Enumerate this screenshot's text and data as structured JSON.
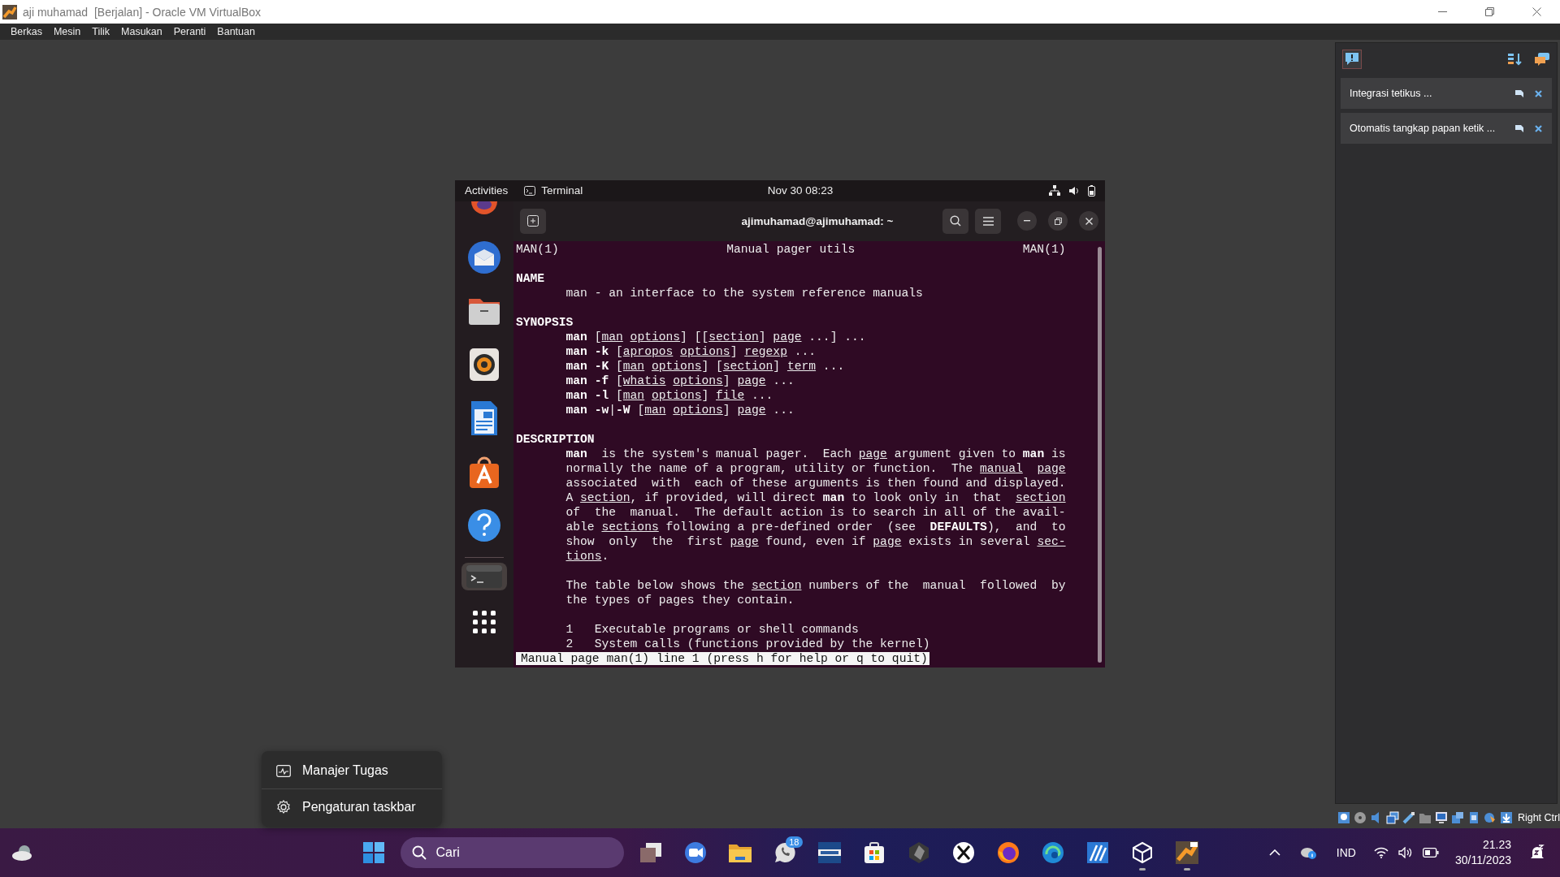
{
  "window": {
    "title": "aji muhamad  [Berjalan] - Oracle VM VirtualBox"
  },
  "menu": [
    "Berkas",
    "Mesin",
    "Tilik",
    "Masukan",
    "Peranti",
    "Bantuan"
  ],
  "notifications": [
    {
      "text": "Integrasi tetikus ..."
    },
    {
      "text": "Otomatis tangkap papan ketik ..."
    }
  ],
  "guest": {
    "top_bar": {
      "activities": "Activities",
      "app": "Terminal",
      "clock": "Nov 30  08:23"
    },
    "dock": [
      {
        "active": false
      },
      {
        "active": false
      },
      {
        "active": false
      },
      {
        "active": false
      },
      {
        "active": false
      },
      {
        "active": false
      },
      {
        "active": false
      },
      {
        "active": true
      },
      {
        "active": false
      }
    ],
    "terminal": {
      "title": "ajimuhamad@ajimuhamad: ~",
      "header": {
        "left": "MAN(1)",
        "center": "Manual pager utils",
        "right": "MAN(1)"
      },
      "lines": [
        {
          "kind": "blank"
        },
        {
          "kind": "heading",
          "segments": [
            {
              "text": "NAME",
              "kind": "bold"
            }
          ]
        },
        {
          "kind": "body",
          "segments": [
            {
              "text": "man - an interface to the system reference manuals",
              "kind": "plain"
            }
          ]
        },
        {
          "kind": "blank"
        },
        {
          "kind": "heading",
          "segments": [
            {
              "text": "SYNOPSIS",
              "kind": "bold"
            }
          ]
        },
        {
          "kind": "body",
          "segments": [
            {
              "text": "man",
              "kind": "bold"
            },
            {
              "text": " [",
              "kind": "plain"
            },
            {
              "text": "man options",
              "kind": "underline"
            },
            {
              "text": "] [[",
              "kind": "plain"
            },
            {
              "text": "section",
              "kind": "underline"
            },
            {
              "text": "] ",
              "kind": "plain"
            },
            {
              "text": "page",
              "kind": "underline"
            },
            {
              "text": " ...] ...",
              "kind": "plain"
            }
          ]
        },
        {
          "kind": "body",
          "segments": [
            {
              "text": "man -k",
              "kind": "bold"
            },
            {
              "text": " [",
              "kind": "plain"
            },
            {
              "text": "apropos options",
              "kind": "underline"
            },
            {
              "text": "] ",
              "kind": "plain"
            },
            {
              "text": "regexp",
              "kind": "underline"
            },
            {
              "text": " ...",
              "kind": "plain"
            }
          ]
        },
        {
          "kind": "body",
          "segments": [
            {
              "text": "man -K",
              "kind": "bold"
            },
            {
              "text": " [",
              "kind": "plain"
            },
            {
              "text": "man options",
              "kind": "underline"
            },
            {
              "text": "] [",
              "kind": "plain"
            },
            {
              "text": "section",
              "kind": "underline"
            },
            {
              "text": "] ",
              "kind": "plain"
            },
            {
              "text": "term",
              "kind": "underline"
            },
            {
              "text": " ...",
              "kind": "plain"
            }
          ]
        },
        {
          "kind": "body",
          "segments": [
            {
              "text": "man -f",
              "kind": "bold"
            },
            {
              "text": " [",
              "kind": "plain"
            },
            {
              "text": "whatis options",
              "kind": "underline"
            },
            {
              "text": "] ",
              "kind": "plain"
            },
            {
              "text": "page",
              "kind": "underline"
            },
            {
              "text": " ...",
              "kind": "plain"
            }
          ]
        },
        {
          "kind": "body",
          "segments": [
            {
              "text": "man -l",
              "kind": "bold"
            },
            {
              "text": " [",
              "kind": "plain"
            },
            {
              "text": "man options",
              "kind": "underline"
            },
            {
              "text": "] ",
              "kind": "plain"
            },
            {
              "text": "file",
              "kind": "underline"
            },
            {
              "text": " ...",
              "kind": "plain"
            }
          ]
        },
        {
          "kind": "body",
          "segments": [
            {
              "text": "man -w",
              "kind": "bold"
            },
            {
              "text": "|",
              "kind": "plain"
            },
            {
              "text": "-W",
              "kind": "bold"
            },
            {
              "text": " [",
              "kind": "plain"
            },
            {
              "text": "man options",
              "kind": "underline"
            },
            {
              "text": "] ",
              "kind": "plain"
            },
            {
              "text": "page",
              "kind": "underline"
            },
            {
              "text": " ...",
              "kind": "plain"
            }
          ]
        },
        {
          "kind": "blank"
        },
        {
          "kind": "heading",
          "segments": [
            {
              "text": "DESCRIPTION",
              "kind": "bold"
            }
          ]
        },
        {
          "kind": "body",
          "segments": [
            {
              "text": "man",
              "kind": "bold"
            },
            {
              "text": "  is the system's manual pager.  Each ",
              "kind": "plain"
            },
            {
              "text": "page",
              "kind": "underline"
            },
            {
              "text": " argument given to ",
              "kind": "plain"
            },
            {
              "text": "man",
              "kind": "bold"
            },
            {
              "text": " is",
              "kind": "plain"
            }
          ]
        },
        {
          "kind": "body",
          "segments": [
            {
              "text": "normally the name of a program, utility or function.  The ",
              "kind": "plain"
            },
            {
              "text": "manual  page",
              "kind": "underline"
            }
          ]
        },
        {
          "kind": "body",
          "segments": [
            {
              "text": "associated  with  each of these arguments is then found and displayed.",
              "kind": "plain"
            }
          ]
        },
        {
          "kind": "body",
          "segments": [
            {
              "text": "A ",
              "kind": "plain"
            },
            {
              "text": "section",
              "kind": "underline"
            },
            {
              "text": ", if provided, will direct ",
              "kind": "plain"
            },
            {
              "text": "man",
              "kind": "bold"
            },
            {
              "text": " to look only in  that  ",
              "kind": "plain"
            },
            {
              "text": "section",
              "kind": "underline"
            }
          ]
        },
        {
          "kind": "body",
          "segments": [
            {
              "text": "of  the  manual.  The default action is to search in all of the avail-",
              "kind": "plain"
            }
          ]
        },
        {
          "kind": "body",
          "segments": [
            {
              "text": "able ",
              "kind": "plain"
            },
            {
              "text": "sections",
              "kind": "underline"
            },
            {
              "text": " following a pre-defined order  (see  ",
              "kind": "plain"
            },
            {
              "text": "DEFAULTS",
              "kind": "bold"
            },
            {
              "text": "),  and  to",
              "kind": "plain"
            }
          ]
        },
        {
          "kind": "body",
          "segments": [
            {
              "text": "show  only  the  first ",
              "kind": "plain"
            },
            {
              "text": "page",
              "kind": "underline"
            },
            {
              "text": " found, even if ",
              "kind": "plain"
            },
            {
              "text": "page",
              "kind": "underline"
            },
            {
              "text": " exists in several ",
              "kind": "plain"
            },
            {
              "text": "sec-",
              "kind": "underline"
            }
          ]
        },
        {
          "kind": "body",
          "segments": [
            {
              "text": "tions",
              "kind": "underline"
            },
            {
              "text": ".",
              "kind": "plain"
            }
          ]
        },
        {
          "kind": "blank"
        },
        {
          "kind": "body",
          "segments": [
            {
              "text": "The table below shows the ",
              "kind": "plain"
            },
            {
              "text": "section",
              "kind": "underline"
            },
            {
              "text": " numbers of the  manual  followed  by",
              "kind": "plain"
            }
          ]
        },
        {
          "kind": "body",
          "segments": [
            {
              "text": "the types of pages they contain.",
              "kind": "plain"
            }
          ]
        },
        {
          "kind": "blank"
        },
        {
          "kind": "body",
          "segments": [
            {
              "text": "1   Executable programs or shell commands",
              "kind": "plain"
            }
          ]
        },
        {
          "kind": "body",
          "segments": [
            {
              "text": "2   System calls (functions provided by the kernel)",
              "kind": "plain"
            }
          ]
        }
      ],
      "status_line": "Manual page man(1) line 1 (press h for help or q to quit)"
    }
  },
  "status_bar": {
    "host_key": "Right Ctrl"
  },
  "context_menu": [
    "Manajer Tugas",
    "Pengaturan taskbar"
  ],
  "taskbar": {
    "search": {
      "placeholder": "Cari"
    },
    "apps": [
      {
        "running": false
      },
      {
        "running": false
      },
      {
        "running": false
      },
      {
        "running": false,
        "badge": "18"
      },
      {
        "running": false
      },
      {
        "running": false
      },
      {
        "running": false
      },
      {
        "running": false
      },
      {
        "running": false
      },
      {
        "running": false
      },
      {
        "running": false
      },
      {
        "running": true
      },
      {
        "running": true
      }
    ],
    "tray": {
      "language": "IND",
      "time": "21.23",
      "date": "30/11/2023"
    }
  }
}
